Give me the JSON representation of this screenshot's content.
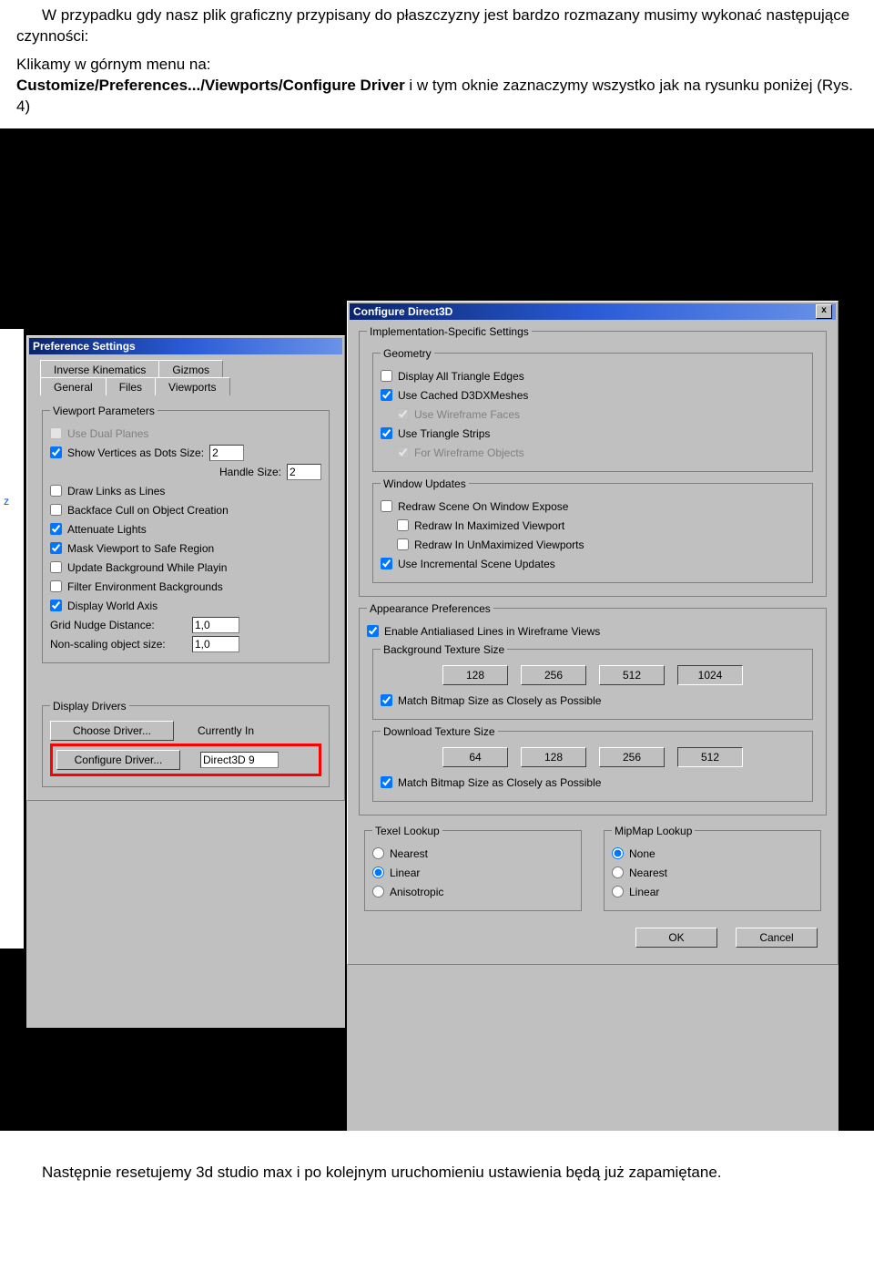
{
  "intro": {
    "p1": "W przypadku gdy nasz plik graficzny przypisany do płaszczyzny jest bardzo rozmazany musimy wykonać następujące czynności:",
    "p2_pre": "Klikamy w górnym menu na:",
    "p2_bold": "Customize/Preferences.../Viewports/Configure Driver",
    "p2_post": " i w tym oknie zaznaczymy wszystko jak na rysunku poniżej (Rys. 4)"
  },
  "axis_label": "z",
  "prefDialog": {
    "title": "Preference Settings",
    "tabs_row1": [
      "Inverse Kinematics",
      "Gizmos"
    ],
    "tabs_row2": [
      "General",
      "Files",
      "Viewports"
    ],
    "viewportParams": {
      "legend": "Viewport Parameters",
      "useDualPlanes": "Use Dual Planes",
      "showVertices": "Show Vertices as Dots   Size:",
      "sizeVal": "2",
      "handleSizeLabel": "Handle Size:",
      "handleSizeVal": "2",
      "drawLinks": "Draw Links as Lines",
      "backface": "Backface Cull on Object Creation",
      "attenuate": "Attenuate Lights",
      "mask": "Mask Viewport to Safe Region",
      "updateBg": "Update Background While Playin",
      "filterEnv": "Filter Environment Backgrounds",
      "displayAxis": "Display World Axis",
      "gridLabel": "Grid Nudge Distance:",
      "gridVal": "1,0",
      "nonScaleLabel": "Non-scaling object size:",
      "nonScaleVal": "1,0"
    },
    "displayDrivers": {
      "legend": "Display Drivers",
      "choose": "Choose Driver...",
      "currently": "Currently In",
      "configure": "Configure Driver...",
      "direct3d": "Direct3D 9"
    }
  },
  "cfgDialog": {
    "title": "Configure Direct3D",
    "impl": {
      "legend": "Implementation-Specific Settings",
      "geometry": {
        "legend": "Geometry",
        "dispTri": "Display All Triangle Edges",
        "useCached": "Use Cached D3DXMeshes",
        "useWire": "Use Wireframe Faces",
        "useTriStrips": "Use Triangle Strips",
        "forWire": "For Wireframe Objects"
      },
      "windowUpdates": {
        "legend": "Window Updates",
        "redrawExpose": "Redraw Scene On Window Expose",
        "redrawMax": "Redraw In Maximized Viewport",
        "redrawUnMax": "Redraw In UnMaximized Viewports",
        "incremental": "Use Incremental Scene Updates"
      }
    },
    "appearance": {
      "legend": "Appearance Preferences",
      "enableAA": "Enable Antialiased Lines in Wireframe Views",
      "bgTex": {
        "legend": "Background Texture Size",
        "b1": "128",
        "b2": "256",
        "b3": "512",
        "b4": "1024",
        "match": "Match Bitmap Size as Closely as Possible"
      },
      "dlTex": {
        "legend": "Download Texture Size",
        "b1": "64",
        "b2": "128",
        "b3": "256",
        "b4": "512",
        "match": "Match Bitmap Size as Closely as Possible"
      }
    },
    "texel": {
      "legend": "Texel Lookup",
      "nearest": "Nearest",
      "linear": "Linear",
      "aniso": "Anisotropic"
    },
    "mipmap": {
      "legend": "MipMap Lookup",
      "none": "None",
      "nearest": "Nearest",
      "linear": "Linear"
    },
    "ok": "OK",
    "cancel": "Cancel"
  },
  "outro": "Następnie resetujemy 3d studio max i po kolejnym uruchomieniu ustawienia będą już zapamiętane."
}
